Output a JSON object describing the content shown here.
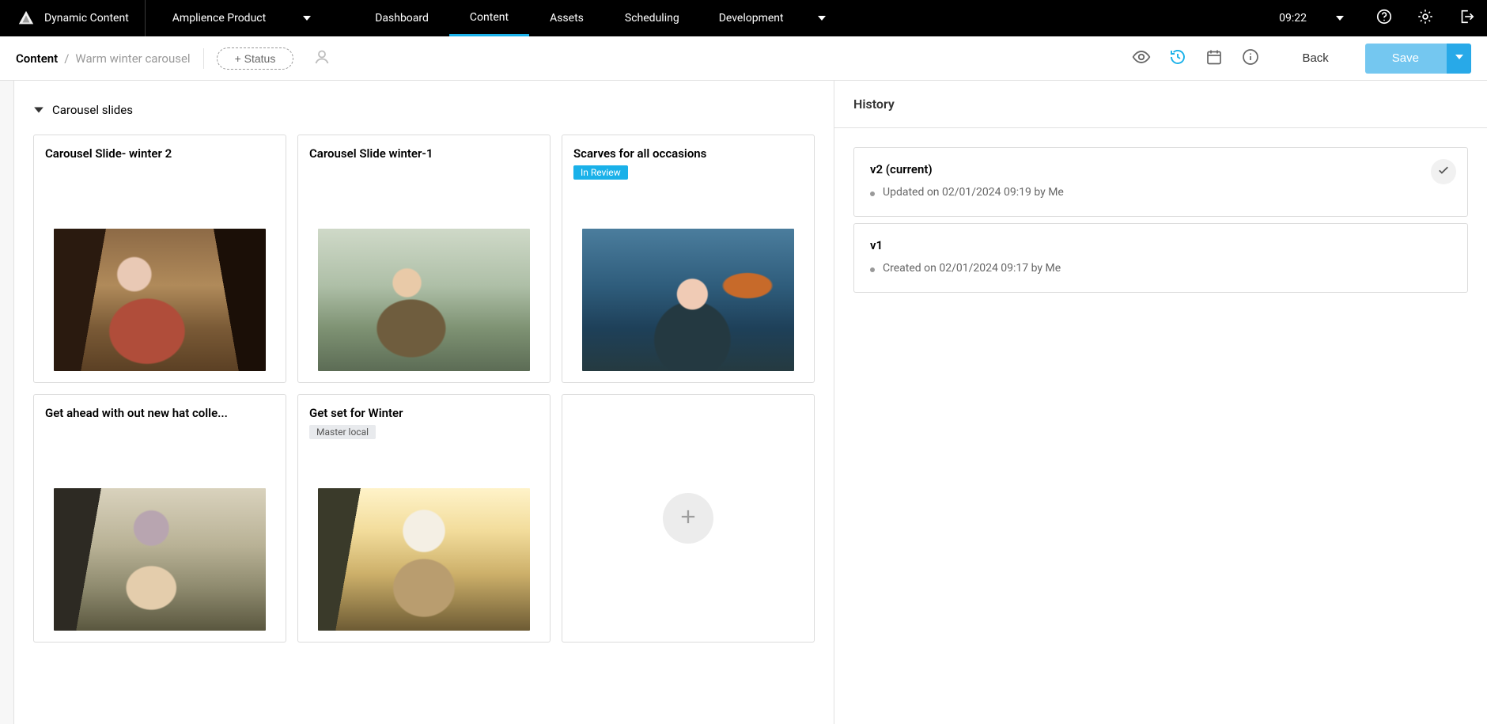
{
  "header": {
    "app_name": "Dynamic Content",
    "hub_name": "Amplience Product",
    "nav": {
      "dashboard": "Dashboard",
      "content": "Content",
      "assets": "Assets",
      "scheduling": "Scheduling"
    },
    "environment": "Development",
    "time": "09:22"
  },
  "subheader": {
    "crumb_root": "Content",
    "crumb_current": "Warm winter carousel",
    "status_button": "+ Status",
    "back_label": "Back",
    "save_label": "Save"
  },
  "editor": {
    "section_title": "Carousel slides",
    "cards": [
      {
        "title": "Carousel Slide- winter 2",
        "badge": null,
        "badge_style": null
      },
      {
        "title": "Carousel Slide winter-1",
        "badge": null,
        "badge_style": null
      },
      {
        "title": "Scarves for all occasions",
        "badge": "In Review",
        "badge_style": "accent"
      },
      {
        "title": "Get ahead with out new hat colle...",
        "badge": null,
        "badge_style": null
      },
      {
        "title": "Get set for Winter",
        "badge": "Master local",
        "badge_style": "neutral"
      }
    ]
  },
  "history": {
    "panel_title": "History",
    "versions": [
      {
        "title": "v2 (current)",
        "meta": "Updated on 02/01/2024 09:19 by Me",
        "checked": true
      },
      {
        "title": "v1",
        "meta": "Created on 02/01/2024 09:17 by Me",
        "checked": false
      }
    ]
  },
  "icons": {
    "logo": "triangle-logo",
    "caret": "caret-down",
    "help": "help-circle",
    "settings": "gear",
    "logout": "exit",
    "preview": "eye",
    "history": "history-clock",
    "schedule": "calendar",
    "info": "info-circle",
    "assign": "user-outline",
    "add": "plus",
    "check": "check"
  },
  "colors": {
    "accent": "#1ab1e9",
    "accent_dark": "#039be5",
    "header_bg": "#000000"
  }
}
